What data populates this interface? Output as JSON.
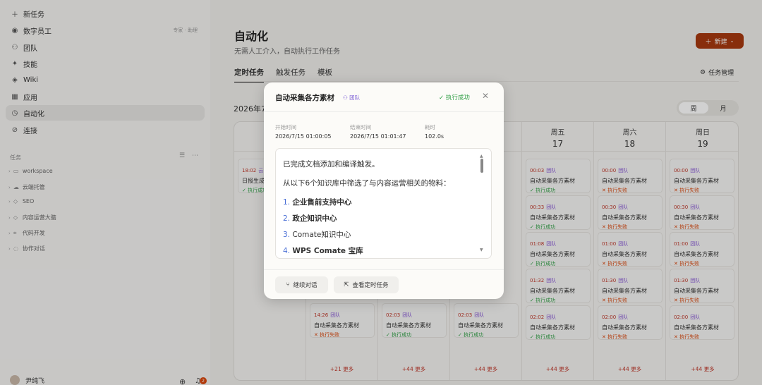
{
  "sidebar": {
    "new_task": "新任务",
    "items": [
      {
        "label": "数字员工",
        "hint": "专家 · 助理"
      },
      {
        "label": "团队"
      },
      {
        "label": "技能"
      },
      {
        "label": "Wiki"
      },
      {
        "label": "应用"
      },
      {
        "label": "自动化"
      },
      {
        "label": "连接"
      }
    ],
    "section_title": "任务",
    "tree": [
      "workspace",
      "云端托管",
      "SEO",
      "内容运营大脑",
      "代码开发",
      "协作对话"
    ],
    "user_name": "尹纯飞",
    "notif_count": "2"
  },
  "main": {
    "title": "自动化",
    "subtitle": "无需人工介入，自动执行工作任务",
    "new_button": "新建",
    "tabs": [
      "定时任务",
      "触发任务",
      "模板"
    ],
    "task_manager": "任务管理",
    "date": "2026年7",
    "view_toggle": [
      "周",
      "月"
    ]
  },
  "calendar": {
    "days": [
      {
        "weekday": "",
        "day": ""
      },
      {
        "weekday": "",
        "day": ""
      },
      {
        "weekday": "",
        "day": ""
      },
      {
        "weekday": "",
        "day": ""
      },
      {
        "weekday": "周五",
        "day": "17"
      },
      {
        "weekday": "周六",
        "day": "18"
      },
      {
        "weekday": "周日",
        "day": "19"
      }
    ],
    "team_tag": "团队",
    "task_name": "自动采集各方素材",
    "status_ok": "执行成功",
    "status_fail": "执行失败",
    "col1_cards": [
      {
        "time": "18:02",
        "tag": "云",
        "name": "日报生成",
        "status": "执行成功",
        "ok": true
      }
    ],
    "col2_cards": [
      {
        "time": "14:26",
        "tag": "团队",
        "name": "自动采集各方素材",
        "status": "执行失败",
        "ok": false
      }
    ],
    "col3_cards": [
      {
        "time": "02:03",
        "tag": "团队",
        "name": "自动采集各方素材",
        "status": "执行成功",
        "ok": true
      }
    ],
    "col4_cards": [
      {
        "time": "02:03",
        "tag": "团队",
        "name": "自动采集各方素材",
        "status": "执行成功",
        "ok": true
      }
    ],
    "col5_cards": [
      {
        "time": "00:03",
        "tag": "团队",
        "name": "自动采集各方素材",
        "status": "执行成功",
        "ok": true
      },
      {
        "time": "00:33",
        "tag": "团队",
        "name": "自动采集各方素材",
        "status": "执行成功",
        "ok": true
      },
      {
        "time": "01:08",
        "tag": "团队",
        "name": "自动采集各方素材",
        "status": "执行成功",
        "ok": true
      },
      {
        "time": "01:32",
        "tag": "团队",
        "name": "自动采集各方素材",
        "status": "执行成功",
        "ok": true
      },
      {
        "time": "02:02",
        "tag": "团队",
        "name": "自动采集各方素材",
        "status": "执行成功",
        "ok": true
      }
    ],
    "col6_cards": [
      {
        "time": "00:00",
        "tag": "团队",
        "name": "自动采集各方素材",
        "status": "执行失败",
        "ok": false
      },
      {
        "time": "00:30",
        "tag": "团队",
        "name": "自动采集各方素材",
        "status": "执行失败",
        "ok": false
      },
      {
        "time": "01:00",
        "tag": "团队",
        "name": "自动采集各方素材",
        "status": "执行失败",
        "ok": false
      },
      {
        "time": "01:30",
        "tag": "团队",
        "name": "自动采集各方素材",
        "status": "执行失败",
        "ok": false
      },
      {
        "time": "02:00",
        "tag": "团队",
        "name": "自动采集各方素材",
        "status": "执行失败",
        "ok": false
      }
    ],
    "col7_cards": [
      {
        "time": "00:00",
        "tag": "团队",
        "name": "自动采集各方素材",
        "status": "执行失败",
        "ok": false
      },
      {
        "time": "00:30",
        "tag": "团队",
        "name": "自动采集各方素材",
        "status": "执行失败",
        "ok": false
      },
      {
        "time": "01:00",
        "tag": "团队",
        "name": "自动采集各方素材",
        "status": "执行失败",
        "ok": false
      },
      {
        "time": "01:30",
        "tag": "团队",
        "name": "自动采集各方素材",
        "status": "执行失败",
        "ok": false
      },
      {
        "time": "02:00",
        "tag": "团队",
        "name": "自动采集各方素材",
        "status": "执行失败",
        "ok": false
      }
    ],
    "more": [
      "",
      "+21 更多",
      "+44 更多",
      "+44 更多",
      "+44 更多",
      "+44 更多",
      "+44 更多"
    ]
  },
  "modal": {
    "title": "自动采集各方素材",
    "badge": "团队",
    "status": "执行成功",
    "start_label": "开始时间",
    "start_value": "2026/7/15 01:00:05",
    "end_label": "结束时间",
    "end_value": "2026/7/15 01:01:47",
    "duration_label": "耗时",
    "duration_value": "102.0s",
    "para1": "已完成文档添加和编译触发。",
    "para2": "从以下6个知识库中筛选了与内容运营相关的物料：",
    "list": [
      {
        "num": "1.",
        "text": "企业售前支持中心"
      },
      {
        "num": "2.",
        "text": "政企知识中心"
      },
      {
        "num": "3.",
        "text": "Comate知识中心"
      },
      {
        "num": "4.",
        "text": "WPS Comate 宝库"
      }
    ],
    "btn_continue": "继续对话",
    "btn_view": "查看定时任务"
  },
  "colors": {
    "accent": "#a7390f",
    "success": "#2f9e44",
    "fail": "#d9480f",
    "tag": "#8a5cd6"
  }
}
